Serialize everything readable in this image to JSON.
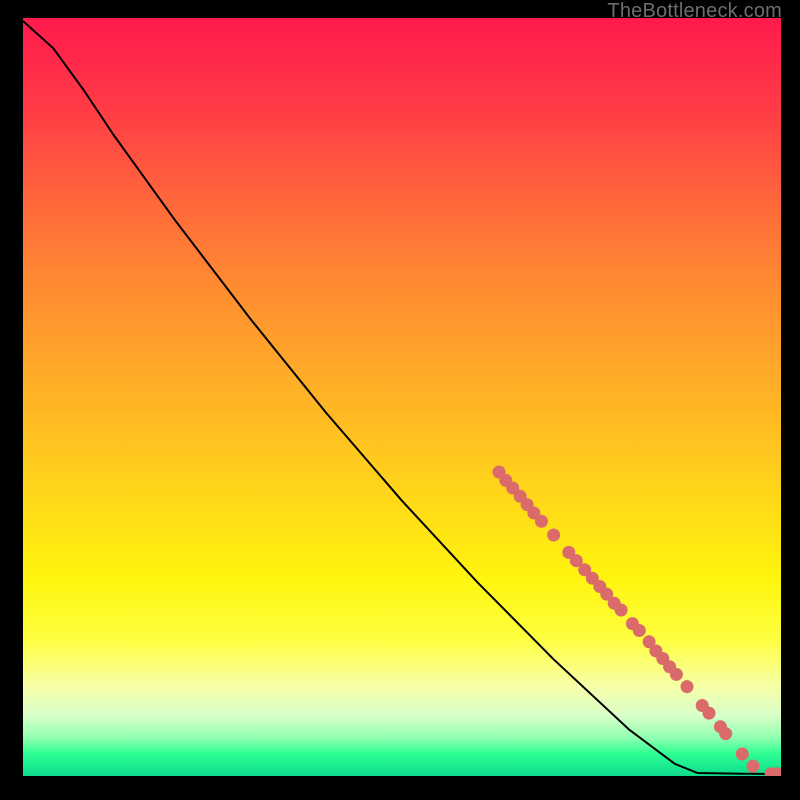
{
  "watermark": "TheBottleneck.com",
  "chart_data": {
    "type": "line",
    "title": "",
    "xlabel": "",
    "ylabel": "",
    "xlim": [
      0,
      100
    ],
    "ylim": [
      0,
      100
    ],
    "curve": [
      {
        "x": 0.0,
        "y": 99.6
      },
      {
        "x": 4.0,
        "y": 96.0
      },
      {
        "x": 8.0,
        "y": 90.5
      },
      {
        "x": 12.0,
        "y": 84.5
      },
      {
        "x": 20.0,
        "y": 73.4
      },
      {
        "x": 30.0,
        "y": 60.3
      },
      {
        "x": 40.0,
        "y": 47.9
      },
      {
        "x": 50.0,
        "y": 36.3
      },
      {
        "x": 60.0,
        "y": 25.5
      },
      {
        "x": 70.0,
        "y": 15.4
      },
      {
        "x": 80.0,
        "y": 6.1
      },
      {
        "x": 86.0,
        "y": 1.6
      },
      {
        "x": 89.0,
        "y": 0.4
      },
      {
        "x": 95.0,
        "y": 0.3
      },
      {
        "x": 100.0,
        "y": 0.25
      }
    ],
    "markers": [
      {
        "x": 62.8,
        "y": 40.1
      },
      {
        "x": 63.7,
        "y": 39.0
      },
      {
        "x": 64.6,
        "y": 38.0
      },
      {
        "x": 65.6,
        "y": 36.9
      },
      {
        "x": 66.5,
        "y": 35.8
      },
      {
        "x": 67.4,
        "y": 34.7
      },
      {
        "x": 68.4,
        "y": 33.6
      },
      {
        "x": 70.0,
        "y": 31.8
      },
      {
        "x": 72.0,
        "y": 29.5
      },
      {
        "x": 73.0,
        "y": 28.4
      },
      {
        "x": 74.1,
        "y": 27.2
      },
      {
        "x": 75.1,
        "y": 26.1
      },
      {
        "x": 76.1,
        "y": 25.0
      },
      {
        "x": 77.0,
        "y": 24.0
      },
      {
        "x": 78.0,
        "y": 22.8
      },
      {
        "x": 78.9,
        "y": 21.9
      },
      {
        "x": 80.4,
        "y": 20.1
      },
      {
        "x": 81.3,
        "y": 19.2
      },
      {
        "x": 82.6,
        "y": 17.7
      },
      {
        "x": 83.5,
        "y": 16.5
      },
      {
        "x": 84.4,
        "y": 15.5
      },
      {
        "x": 85.3,
        "y": 14.4
      },
      {
        "x": 86.2,
        "y": 13.4
      },
      {
        "x": 87.6,
        "y": 11.8
      },
      {
        "x": 89.6,
        "y": 9.3
      },
      {
        "x": 90.5,
        "y": 8.3
      },
      {
        "x": 92.0,
        "y": 6.5
      },
      {
        "x": 92.7,
        "y": 5.6
      },
      {
        "x": 94.9,
        "y": 2.9
      },
      {
        "x": 96.3,
        "y": 1.3
      },
      {
        "x": 98.7,
        "y": 0.3
      },
      {
        "x": 99.5,
        "y": 0.3
      }
    ],
    "marker_color": "#db6b6b",
    "line_color": "#000000"
  }
}
